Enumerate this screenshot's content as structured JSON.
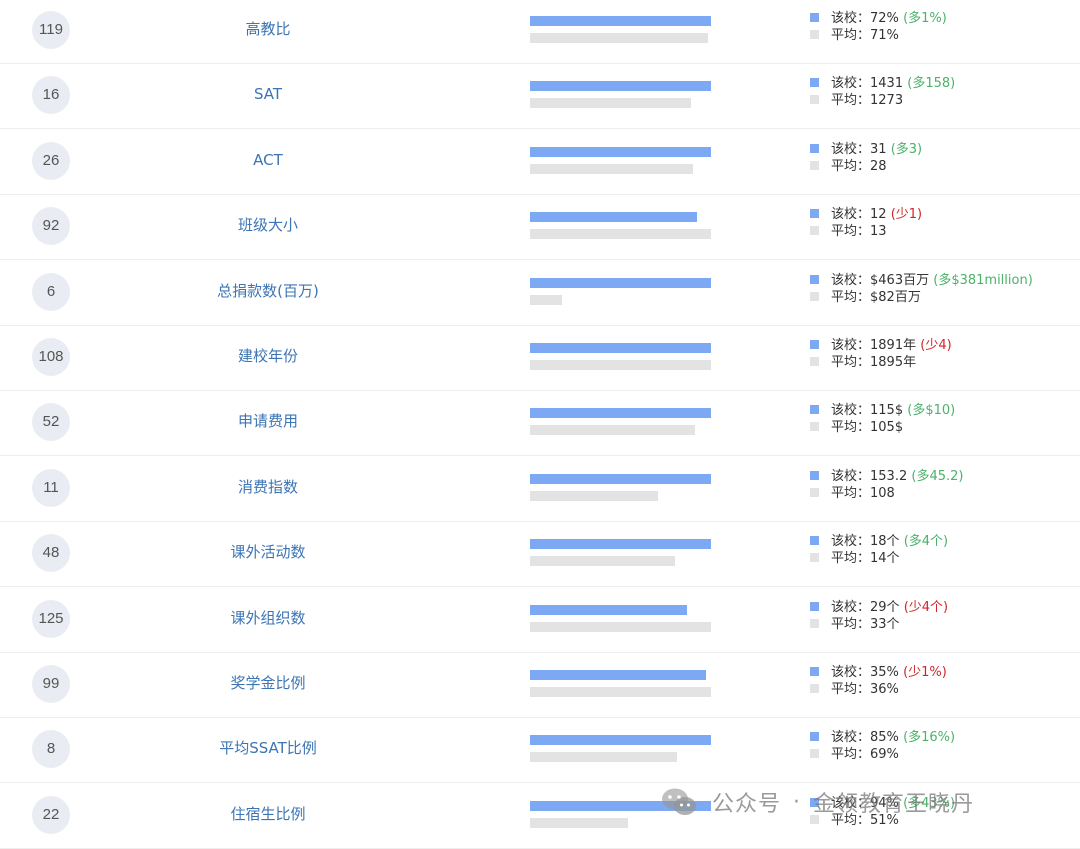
{
  "colors": {
    "school_bar": "#7da8f3",
    "avg_bar": "#e3e3e3",
    "more": "#4bb26a",
    "less": "#d0262b",
    "metric_text": "#3c74b4"
  },
  "labels": {
    "school": "该校：",
    "avg": "平均："
  },
  "rows": [
    {
      "rank": "119",
      "metric": "高教比",
      "school_value": "72%",
      "diff": "(多1%)",
      "diff_dir": "up",
      "avg_value": "71%",
      "school_fraction": 1.0,
      "avg_fraction": 0.986
    },
    {
      "rank": "16",
      "metric": "SAT",
      "school_value": "1431",
      "diff": "(多158)",
      "diff_dir": "up",
      "avg_value": "1273",
      "school_fraction": 1.0,
      "avg_fraction": 0.89
    },
    {
      "rank": "26",
      "metric": "ACT",
      "school_value": "31",
      "diff": "(多3)",
      "diff_dir": "up",
      "avg_value": "28",
      "school_fraction": 1.0,
      "avg_fraction": 0.903
    },
    {
      "rank": "92",
      "metric": "班级大小",
      "school_value": "12",
      "diff": "(少1)",
      "diff_dir": "down",
      "avg_value": "13",
      "school_fraction": 0.923,
      "avg_fraction": 1.0
    },
    {
      "rank": "6",
      "metric": "总捐款数(百万)",
      "school_value": "$463百万",
      "diff": "(多$381million)",
      "diff_dir": "up",
      "avg_value": "$82百万",
      "school_fraction": 1.0,
      "avg_fraction": 0.177
    },
    {
      "rank": "108",
      "metric": "建校年份",
      "school_value": "1891年",
      "diff": "(少4)",
      "diff_dir": "down",
      "avg_value": "1895年",
      "school_fraction": 0.998,
      "avg_fraction": 1.0
    },
    {
      "rank": "52",
      "metric": "申请费用",
      "school_value": "115$",
      "diff": "(多$10)",
      "diff_dir": "up",
      "avg_value": "105$",
      "school_fraction": 1.0,
      "avg_fraction": 0.913
    },
    {
      "rank": "11",
      "metric": "消费指数",
      "school_value": "153.2",
      "diff": "(多45.2)",
      "diff_dir": "up",
      "avg_value": "108",
      "school_fraction": 1.0,
      "avg_fraction": 0.705
    },
    {
      "rank": "48",
      "metric": "课外活动数",
      "school_value": "18个",
      "diff": "(多4个)",
      "diff_dir": "up",
      "avg_value": "14个",
      "school_fraction": 1.0,
      "avg_fraction": 0.8
    },
    {
      "rank": "125",
      "metric": "课外组织数",
      "school_value": "29个",
      "diff": "(少4个)",
      "diff_dir": "down",
      "avg_value": "33个",
      "school_fraction": 0.87,
      "avg_fraction": 1.0
    },
    {
      "rank": "99",
      "metric": "奖学金比例",
      "school_value": "35%",
      "diff": "(少1%)",
      "diff_dir": "down",
      "avg_value": "36%",
      "school_fraction": 0.97,
      "avg_fraction": 1.0
    },
    {
      "rank": "8",
      "metric": "平均SSAT比例",
      "school_value": "85%",
      "diff": "(多16%)",
      "diff_dir": "up",
      "avg_value": "69%",
      "school_fraction": 1.0,
      "avg_fraction": 0.812
    },
    {
      "rank": "22",
      "metric": "住宿生比例",
      "school_value": "94%",
      "diff": "(多43%)",
      "diff_dir": "up",
      "avg_value": "51%",
      "school_fraction": 1.0,
      "avg_fraction": 0.543
    }
  ],
  "watermark": {
    "icon": "wechat-icon",
    "left": "公众号",
    "right": "金领教育王晓丹"
  }
}
